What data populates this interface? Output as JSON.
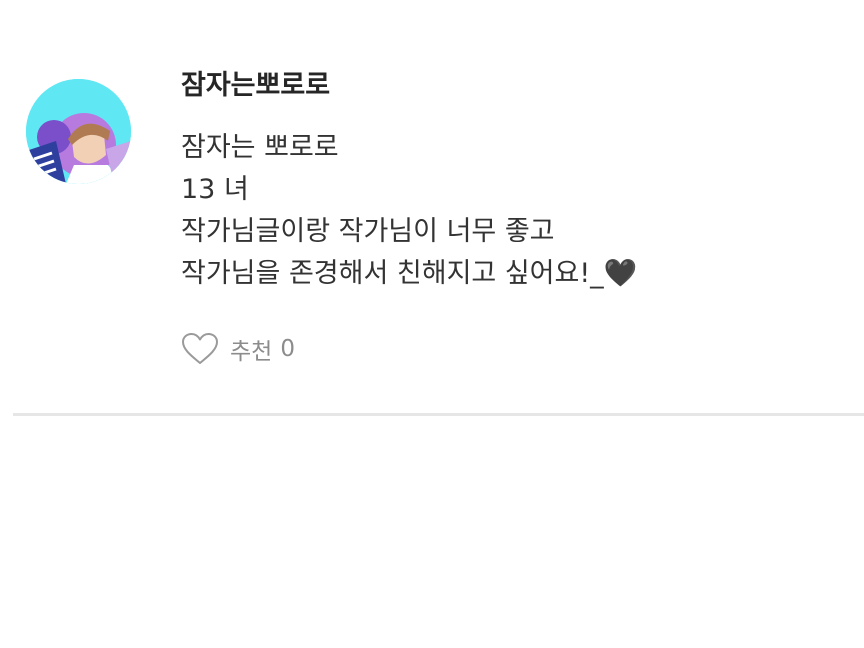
{
  "comment": {
    "author": "잠자는뽀로로",
    "lines": [
      "잠자는 뽀로로",
      "13  녀",
      "작가님글이랑 작가님이 너무 좋고",
      "작가님을 존경해서 친해지고 싶어요!_🖤"
    ],
    "like_label": "추천",
    "like_count": "0"
  },
  "colors": {
    "avatar_background": "#5fe7f4",
    "text": "#333333",
    "muted": "#8c8c8c",
    "divider": "#e6e6e6"
  },
  "icons": {
    "like": "heart-outline-icon"
  }
}
